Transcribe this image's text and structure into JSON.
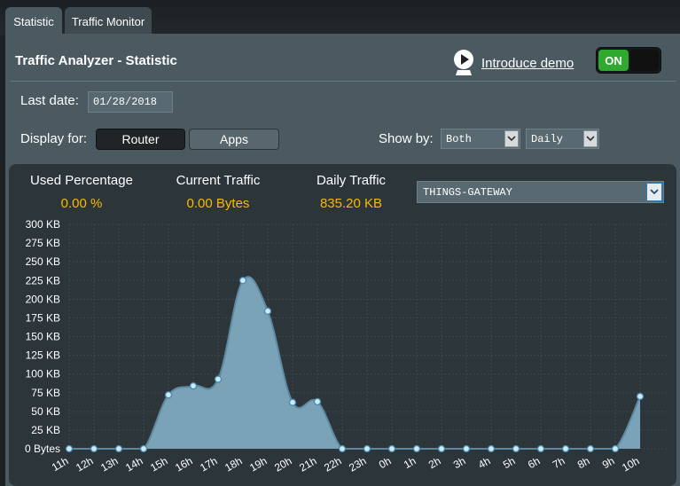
{
  "tabs": [
    {
      "label": "Statistic"
    },
    {
      "label": "Traffic Monitor"
    }
  ],
  "page": {
    "title": "Traffic Analyzer - Statistic",
    "demo_link": "Introduce demo",
    "toggle_label": "ON"
  },
  "form": {
    "last_date_label": "Last date:",
    "last_date_value": "01/28/2018",
    "display_for_label": "Display for:",
    "router_label": "Router",
    "apps_label": "Apps",
    "show_by_label": "Show by:",
    "show_by_value": "Both",
    "period_value": "Daily"
  },
  "stats": {
    "used_percentage_label": "Used Percentage",
    "used_percentage_value": "0.00 %",
    "current_traffic_label": "Current Traffic",
    "current_traffic_value": "0.00 Bytes",
    "daily_traffic_label": "Daily Traffic",
    "daily_traffic_value": "835.20 KB",
    "device": "THINGS-GATEWAY"
  },
  "colors": {
    "accent_value": "#f8bb00",
    "area_fill": "#7aa3b8",
    "line": "#5d8aa1",
    "point": "#c9ecff",
    "toggle_on": "#2faa2f"
  },
  "chart_data": {
    "type": "area",
    "categories": [
      "11h",
      "12h",
      "13h",
      "14h",
      "15h",
      "16h",
      "17h",
      "18h",
      "19h",
      "20h",
      "21h",
      "22h",
      "23h",
      "0h",
      "1h",
      "2h",
      "3h",
      "4h",
      "5h",
      "6h",
      "7h",
      "8h",
      "9h",
      "10h"
    ],
    "values": [
      0,
      0,
      0,
      0,
      72,
      84,
      93,
      225,
      184,
      62,
      63,
      0,
      0,
      0,
      0,
      0,
      0,
      0,
      0,
      0,
      0,
      0,
      0,
      70
    ],
    "y_tick_labels": [
      "0 Bytes",
      "25 KB",
      "50 KB",
      "75 KB",
      "100 KB",
      "125 KB",
      "150 KB",
      "175 KB",
      "200 KB",
      "225 KB",
      "250 KB",
      "275 KB",
      "300 KB"
    ],
    "ylim": [
      0,
      300
    ],
    "y_unit": "KB",
    "grid": true
  }
}
